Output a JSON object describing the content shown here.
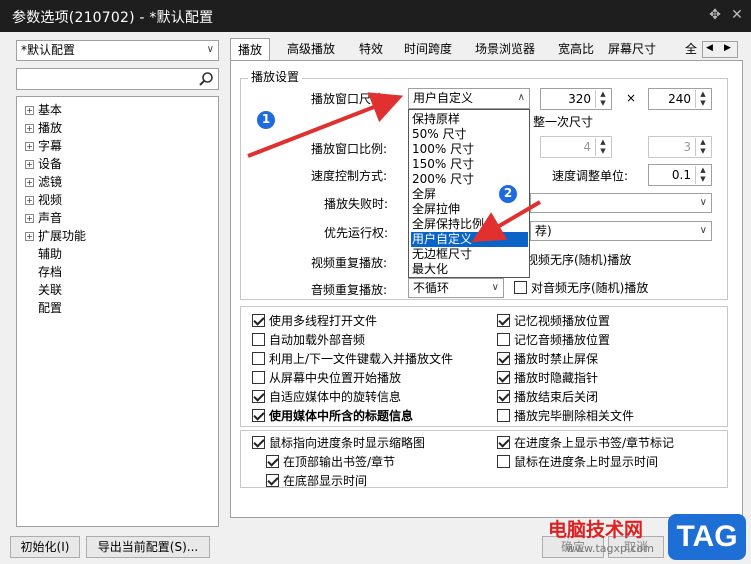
{
  "window": {
    "title": "参数选项(210702) - *默认配置",
    "pin_glyph": "✥",
    "close_glyph": "✕"
  },
  "profile": {
    "selected": "*默认配置"
  },
  "tree": {
    "items": [
      {
        "label": "基本",
        "expandable": true
      },
      {
        "label": "播放",
        "expandable": true
      },
      {
        "label": "字幕",
        "expandable": true
      },
      {
        "label": "设备",
        "expandable": true
      },
      {
        "label": "滤镜",
        "expandable": true
      },
      {
        "label": "视频",
        "expandable": true
      },
      {
        "label": "声音",
        "expandable": true
      },
      {
        "label": "扩展功能",
        "expandable": true
      },
      {
        "label": "辅助",
        "expandable": false
      },
      {
        "label": "存档",
        "expandable": false
      },
      {
        "label": "关联",
        "expandable": false
      },
      {
        "label": "配置",
        "expandable": false
      }
    ]
  },
  "tabs": [
    "播放",
    "高级播放",
    "特效",
    "时间跨度",
    "场景浏览器",
    "宽高比",
    "屏幕尺寸",
    "全"
  ],
  "settings": {
    "group_title": "播放设置",
    "window_size_label": "播放窗口尺寸:",
    "window_size_value": "用户自定义",
    "width": "320",
    "times": "×",
    "height": "240",
    "resize_once_text": "整一次尺寸",
    "ratio_label": "播放窗口比例:",
    "ratio_a": "4",
    "ratio_b": "3",
    "speed_mode_label": "速度控制方式:",
    "speed_unit_label": "速度调整单位:",
    "speed_unit_value": "0.1",
    "fail_label": "播放失败时:",
    "priority_label": "优先运行权:",
    "priority_value": "荐)",
    "video_repeat_label": "视频重复播放:",
    "video_random_label": "对视频无序(随机)播放",
    "audio_repeat_label": "音频重复播放:",
    "audio_repeat_value": "不循环",
    "audio_random_label": "对音频无序(随机)播放"
  },
  "dropdown_options": [
    "保持原样",
    "50% 尺寸",
    "100% 尺寸",
    "150% 尺寸",
    "200% 尺寸",
    "全屏",
    "全屏拉伸",
    "全屏保持比例",
    "用户自定义",
    "无边框尺寸",
    "最大化"
  ],
  "checks_left": [
    {
      "label": "使用多线程打开文件",
      "checked": true
    },
    {
      "label": "自动加载外部音频",
      "checked": false
    },
    {
      "label": "利用上/下一文件键载入并播放文件",
      "checked": false
    },
    {
      "label": "从屏幕中央位置开始播放",
      "checked": false
    },
    {
      "label": "自适应媒体中的旋转信息",
      "checked": true
    },
    {
      "label": "使用媒体中所含的标题信息",
      "checked": true
    }
  ],
  "checks_right": [
    {
      "label": "记忆视频播放位置",
      "checked": true
    },
    {
      "label": "记忆音频播放位置",
      "checked": false
    },
    {
      "label": "播放时禁止屏保",
      "checked": true
    },
    {
      "label": "播放时隐藏指针",
      "checked": true
    },
    {
      "label": "播放结束后关闭",
      "checked": true
    },
    {
      "label": "播放完毕删除相关文件",
      "checked": false
    }
  ],
  "thumb_checks": {
    "main": {
      "label": "鼠标指向进度条时显示缩略图",
      "checked": true
    },
    "top": {
      "label": "在顶部输出书签/章节",
      "checked": true
    },
    "bottom": {
      "label": "在底部显示时间",
      "checked": true
    },
    "right1": {
      "label": "在进度条上显示书签/章节标记",
      "checked": true
    },
    "right2": {
      "label": "鼠标在进度条上时显示时间",
      "checked": false
    }
  },
  "buttons": {
    "init": "初始化(I)",
    "export": "导出当前配置(S)...",
    "ok": "确定",
    "cancel": "取消"
  },
  "annotations": {
    "circle1": "1",
    "circle2": "2"
  },
  "watermark": {
    "site": "电脑技术网",
    "url": "www.tagxp.com",
    "badge": "TAG"
  },
  "colors": {
    "titlebar": "#1e1e1e",
    "accent": "#0a64c8",
    "annotation": "#e03030",
    "badge": "#1d6fd6"
  }
}
